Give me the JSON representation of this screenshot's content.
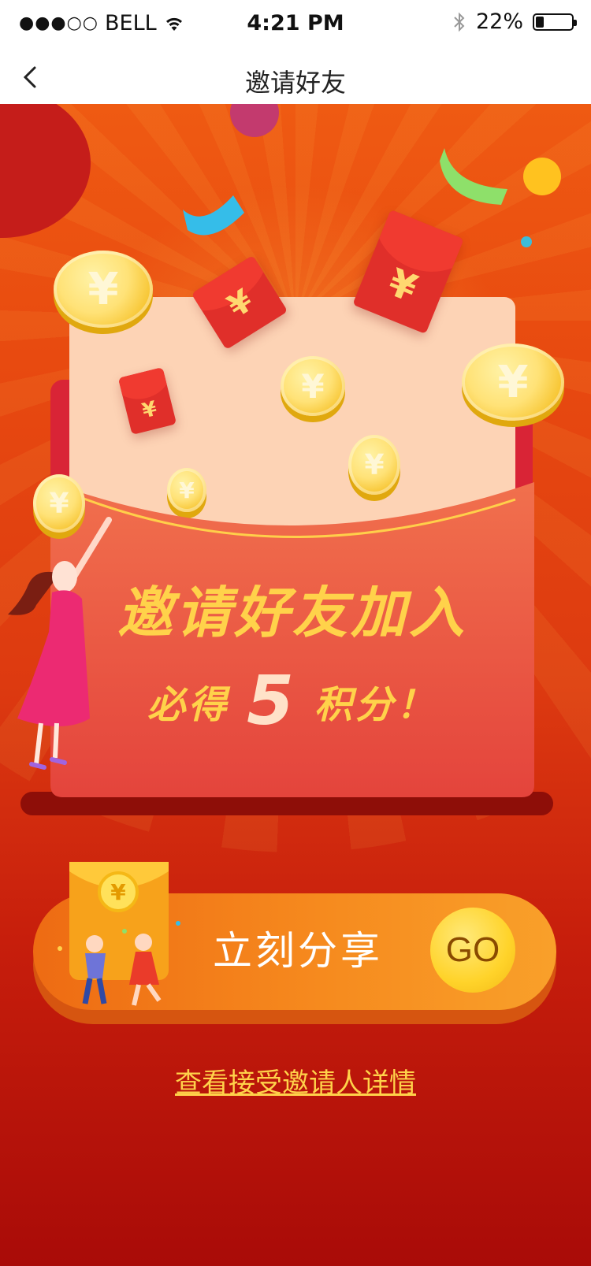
{
  "status_bar": {
    "signal": "●●●○○",
    "carrier": "BELL",
    "time": "4:21 PM",
    "battery_percent": "22%",
    "battery_level": 0.22,
    "icons": [
      "signal-icon",
      "wifi-icon",
      "bluetooth-icon",
      "battery-icon"
    ]
  },
  "nav": {
    "title": "邀请好友",
    "back_icon": "chevron-left-icon"
  },
  "promo": {
    "headline": "邀请好友加入",
    "sub_prefix": "必得",
    "sub_number": "5",
    "sub_suffix": "积分！",
    "currency_symbol": "¥"
  },
  "share": {
    "label": "立刻分享",
    "go_label": "GO",
    "details_link": "查看接受邀请人详情"
  },
  "colors": {
    "background_top": "#ef5a12",
    "background_bottom": "#a90b08",
    "headline": "#ffd24a",
    "share_button": "#f68a1e",
    "go_button": "#ffd32a"
  }
}
